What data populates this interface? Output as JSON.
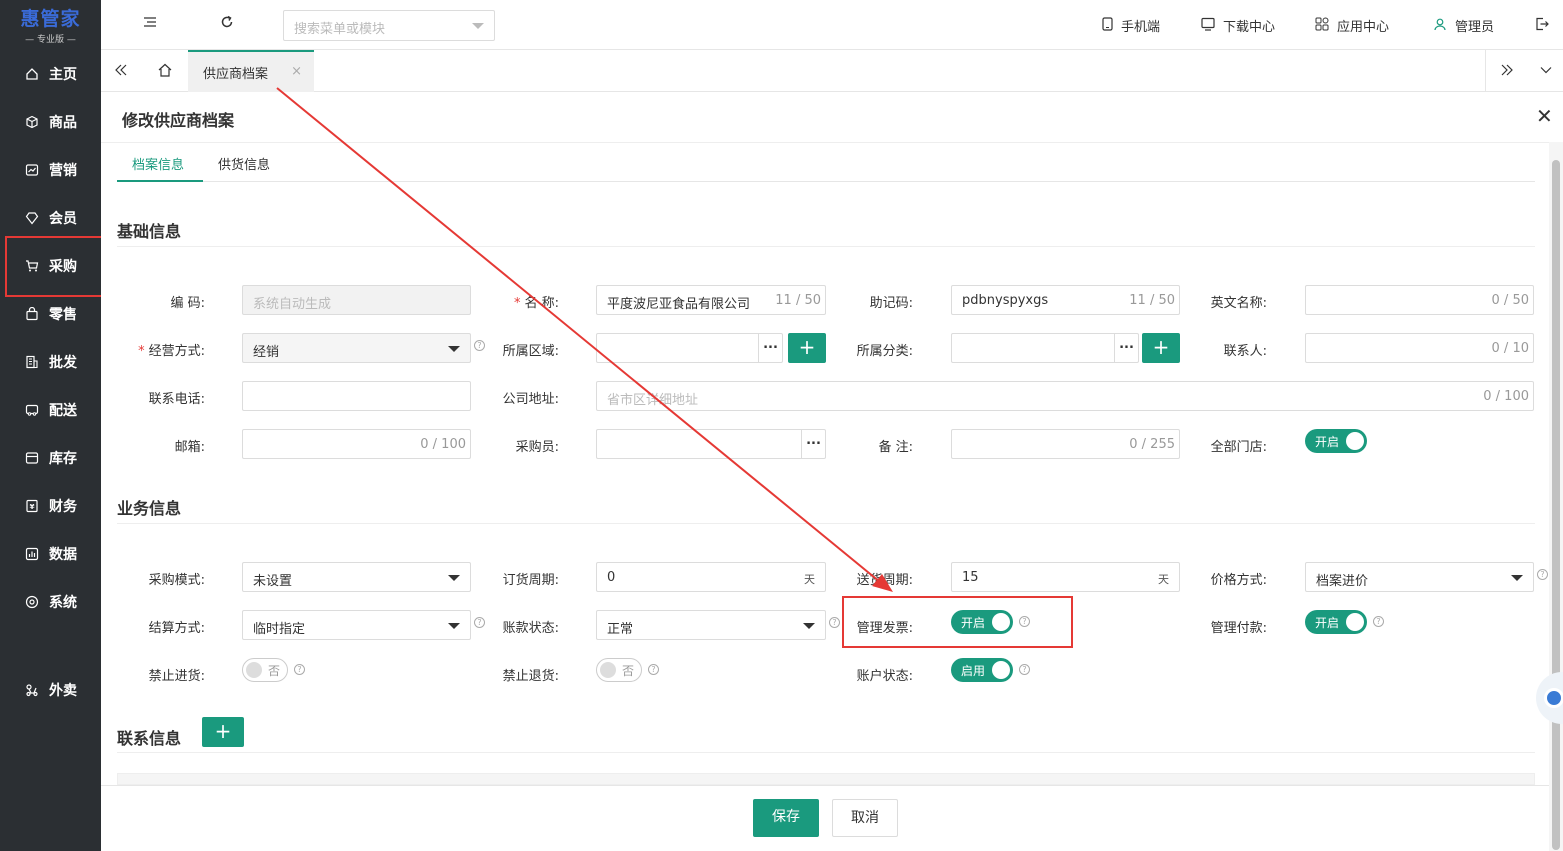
{
  "sidebar": {
    "logo_main": "惠管家",
    "logo_sub": "专业版",
    "items": [
      {
        "label": "主页",
        "icon": "home-icon"
      },
      {
        "label": "商品",
        "icon": "box-icon"
      },
      {
        "label": "营销",
        "icon": "chart-icon"
      },
      {
        "label": "会员",
        "icon": "diamond-icon"
      },
      {
        "label": "采购",
        "icon": "cart-icon"
      },
      {
        "label": "零售",
        "icon": "bag-icon"
      },
      {
        "label": "批发",
        "icon": "building-icon"
      },
      {
        "label": "配送",
        "icon": "truck-icon"
      },
      {
        "label": "库存",
        "icon": "inventory-icon"
      },
      {
        "label": "财务",
        "icon": "finance-icon"
      },
      {
        "label": "数据",
        "icon": "data-icon"
      },
      {
        "label": "系统",
        "icon": "settings-icon"
      },
      {
        "label": "外卖",
        "icon": "delivery-icon"
      }
    ]
  },
  "topbar": {
    "search_placeholder": "搜索菜单或模块",
    "mobile": "手机端",
    "download": "下载中心",
    "apps": "应用中心",
    "user": "管理员"
  },
  "tabs": {
    "active_tab": "供应商档案"
  },
  "dialog": {
    "title": "修改供应商档案",
    "subtab_1": "档案信息",
    "subtab_2": "供货信息"
  },
  "basic": {
    "section": "基础信息",
    "code_label": "编 码:",
    "code_value": "系统自动生成",
    "name_label": "名 称:",
    "name_value": "平度波尼亚食品有限公司",
    "name_count": "11 / 50",
    "mnemonic_label": "助记码:",
    "mnemonic_value": "pdbnyspyxgs",
    "mnemonic_count": "11 / 50",
    "english_label": "英文名称:",
    "english_count": "0 / 50",
    "mode_label": "经营方式:",
    "mode_value": "经销",
    "region_label": "所属区域:",
    "category_label": "所属分类:",
    "contact_label": "联系人:",
    "contact_count": "0 / 10",
    "phone_label": "联系电话:",
    "address_label": "公司地址:",
    "address_placeholder": "省市区详细地址",
    "address_count": "0 / 100",
    "email_label": "邮箱:",
    "email_count": "0 / 100",
    "buyer_label": "采购员:",
    "remark_label": "备 注:",
    "remark_count": "0 / 255",
    "all_stores_label": "全部门店:",
    "all_stores_value": "开启"
  },
  "business": {
    "section": "业务信息",
    "purchase_mode_label": "采购模式:",
    "purchase_mode_value": "未设置",
    "order_cycle_label": "订货周期:",
    "order_cycle_value": "0",
    "delivery_cycle_label": "送货周期:",
    "delivery_cycle_value": "15",
    "unit_day": "天",
    "price_mode_label": "价格方式:",
    "price_mode_value": "档案进价",
    "settle_label": "结算方式:",
    "settle_value": "临时指定",
    "account_status_label": "账款状态:",
    "account_status_value": "正常",
    "manage_invoice_label": "管理发票:",
    "manage_invoice_value": "开启",
    "manage_payment_label": "管理付款:",
    "manage_payment_value": "开启",
    "ban_purchase_label": "禁止进货:",
    "ban_purchase_value": "否",
    "ban_return_label": "禁止退货:",
    "ban_return_value": "否",
    "acct_state_label": "账户状态:",
    "acct_state_value": "启用"
  },
  "contact": {
    "section": "联系信息"
  },
  "footer": {
    "save": "保存",
    "cancel": "取消"
  },
  "colors": {
    "accent": "#1a9a7e",
    "sidebar_bg": "#2b2f33",
    "highlight": "#e53935"
  }
}
